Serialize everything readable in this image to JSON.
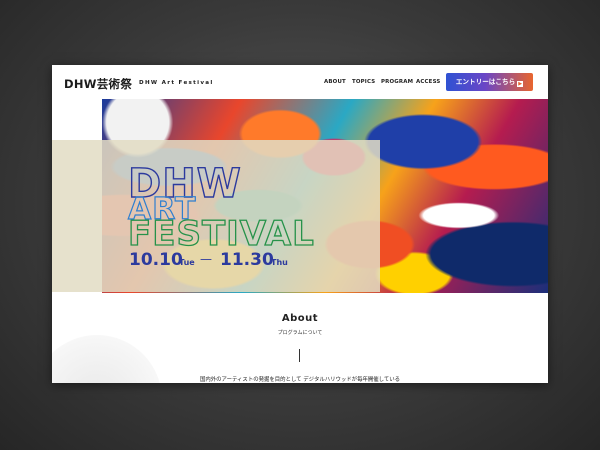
{
  "header": {
    "logo_jp": "DHW芸術祭",
    "logo_en": "DHW Art Festival",
    "nav": [
      "ABOUT",
      "TOPICS",
      "PROGRAM",
      "ACCESS"
    ],
    "entry_button": "エントリーはこちら",
    "entry_arrow": "▶"
  },
  "hero": {
    "title_lines": [
      "DHW",
      "ART",
      "FESTIVAL"
    ],
    "start_date": "10.10",
    "start_day": "Tue",
    "dash": "—",
    "end_date": "11.30",
    "end_day": "Thu",
    "colors": {
      "dhw": "#2c3a9e",
      "art": "#2f7fd0",
      "festival": "#26924a",
      "dates": "#2c3a9e"
    }
  },
  "about": {
    "title": "About",
    "subtitle": "プログラムについて",
    "body": "国内外のアーティストの発掘を目的として デジタルハリウッドが毎年開催している"
  }
}
